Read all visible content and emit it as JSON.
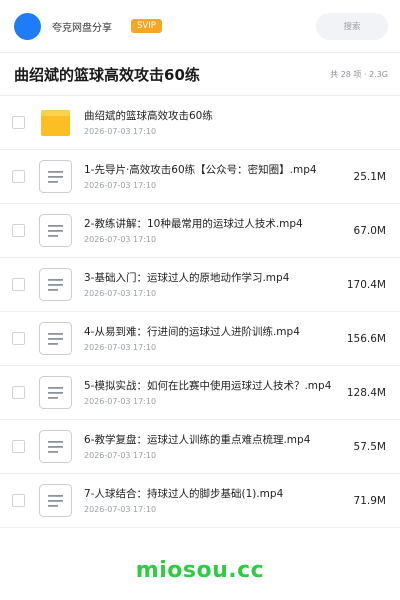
{
  "header": {
    "app_name": "夸克网盘分享",
    "badge": "SVIP",
    "search_label": "搜索",
    "avatar_color": "#1e7cf7"
  },
  "folder": {
    "title": "曲绍斌的篮球高效攻击60练",
    "meta": "共 28 项 · 2.3G"
  },
  "items": [
    {
      "type": "folder",
      "icon": "folder-icon",
      "name": "曲绍斌的篮球高效攻击60练",
      "date": "2026-07-03 17:10",
      "size": ""
    },
    {
      "type": "file",
      "icon": "video-file-icon",
      "name": "1-先导片·高效攻击60练【公众号：密知圈】.mp4",
      "date": "2026-07-03 17:10",
      "size": "25.1M"
    },
    {
      "type": "file",
      "icon": "video-file-icon",
      "name": "2-教练讲解：10种最常用的运球过人技术.mp4",
      "date": "2026-07-03 17:10",
      "size": "67.0M"
    },
    {
      "type": "file",
      "icon": "video-file-icon",
      "name": "3-基础入门：运球过人的原地动作学习.mp4",
      "date": "2026-07-03 17:10",
      "size": "170.4M"
    },
    {
      "type": "file",
      "icon": "video-file-icon",
      "name": "4-从易到难：行进间的运球过人进阶训练.mp4",
      "date": "2026-07-03 17:10",
      "size": "156.6M"
    },
    {
      "type": "file",
      "icon": "video-file-icon",
      "name": "5-模拟实战：如何在比赛中使用运球过人技术？.mp4",
      "date": "2026-07-03 17:10",
      "size": "128.4M"
    },
    {
      "type": "file",
      "icon": "video-file-icon",
      "name": "6-教学复盘：运球过人训练的重点难点梳理.mp4",
      "date": "2026-07-03 17:10",
      "size": "57.5M"
    },
    {
      "type": "file",
      "icon": "video-file-icon",
      "name": "7-人球结合：持球过人的脚步基础(1).mp4",
      "date": "2026-07-03 17:10",
      "size": "71.9M"
    }
  ],
  "watermark": "miosou.cc",
  "colors": {
    "accent": "#1e7cf7",
    "badge": "#f5a623",
    "folder": "#fbbf24",
    "watermark": "#2ecc40"
  }
}
